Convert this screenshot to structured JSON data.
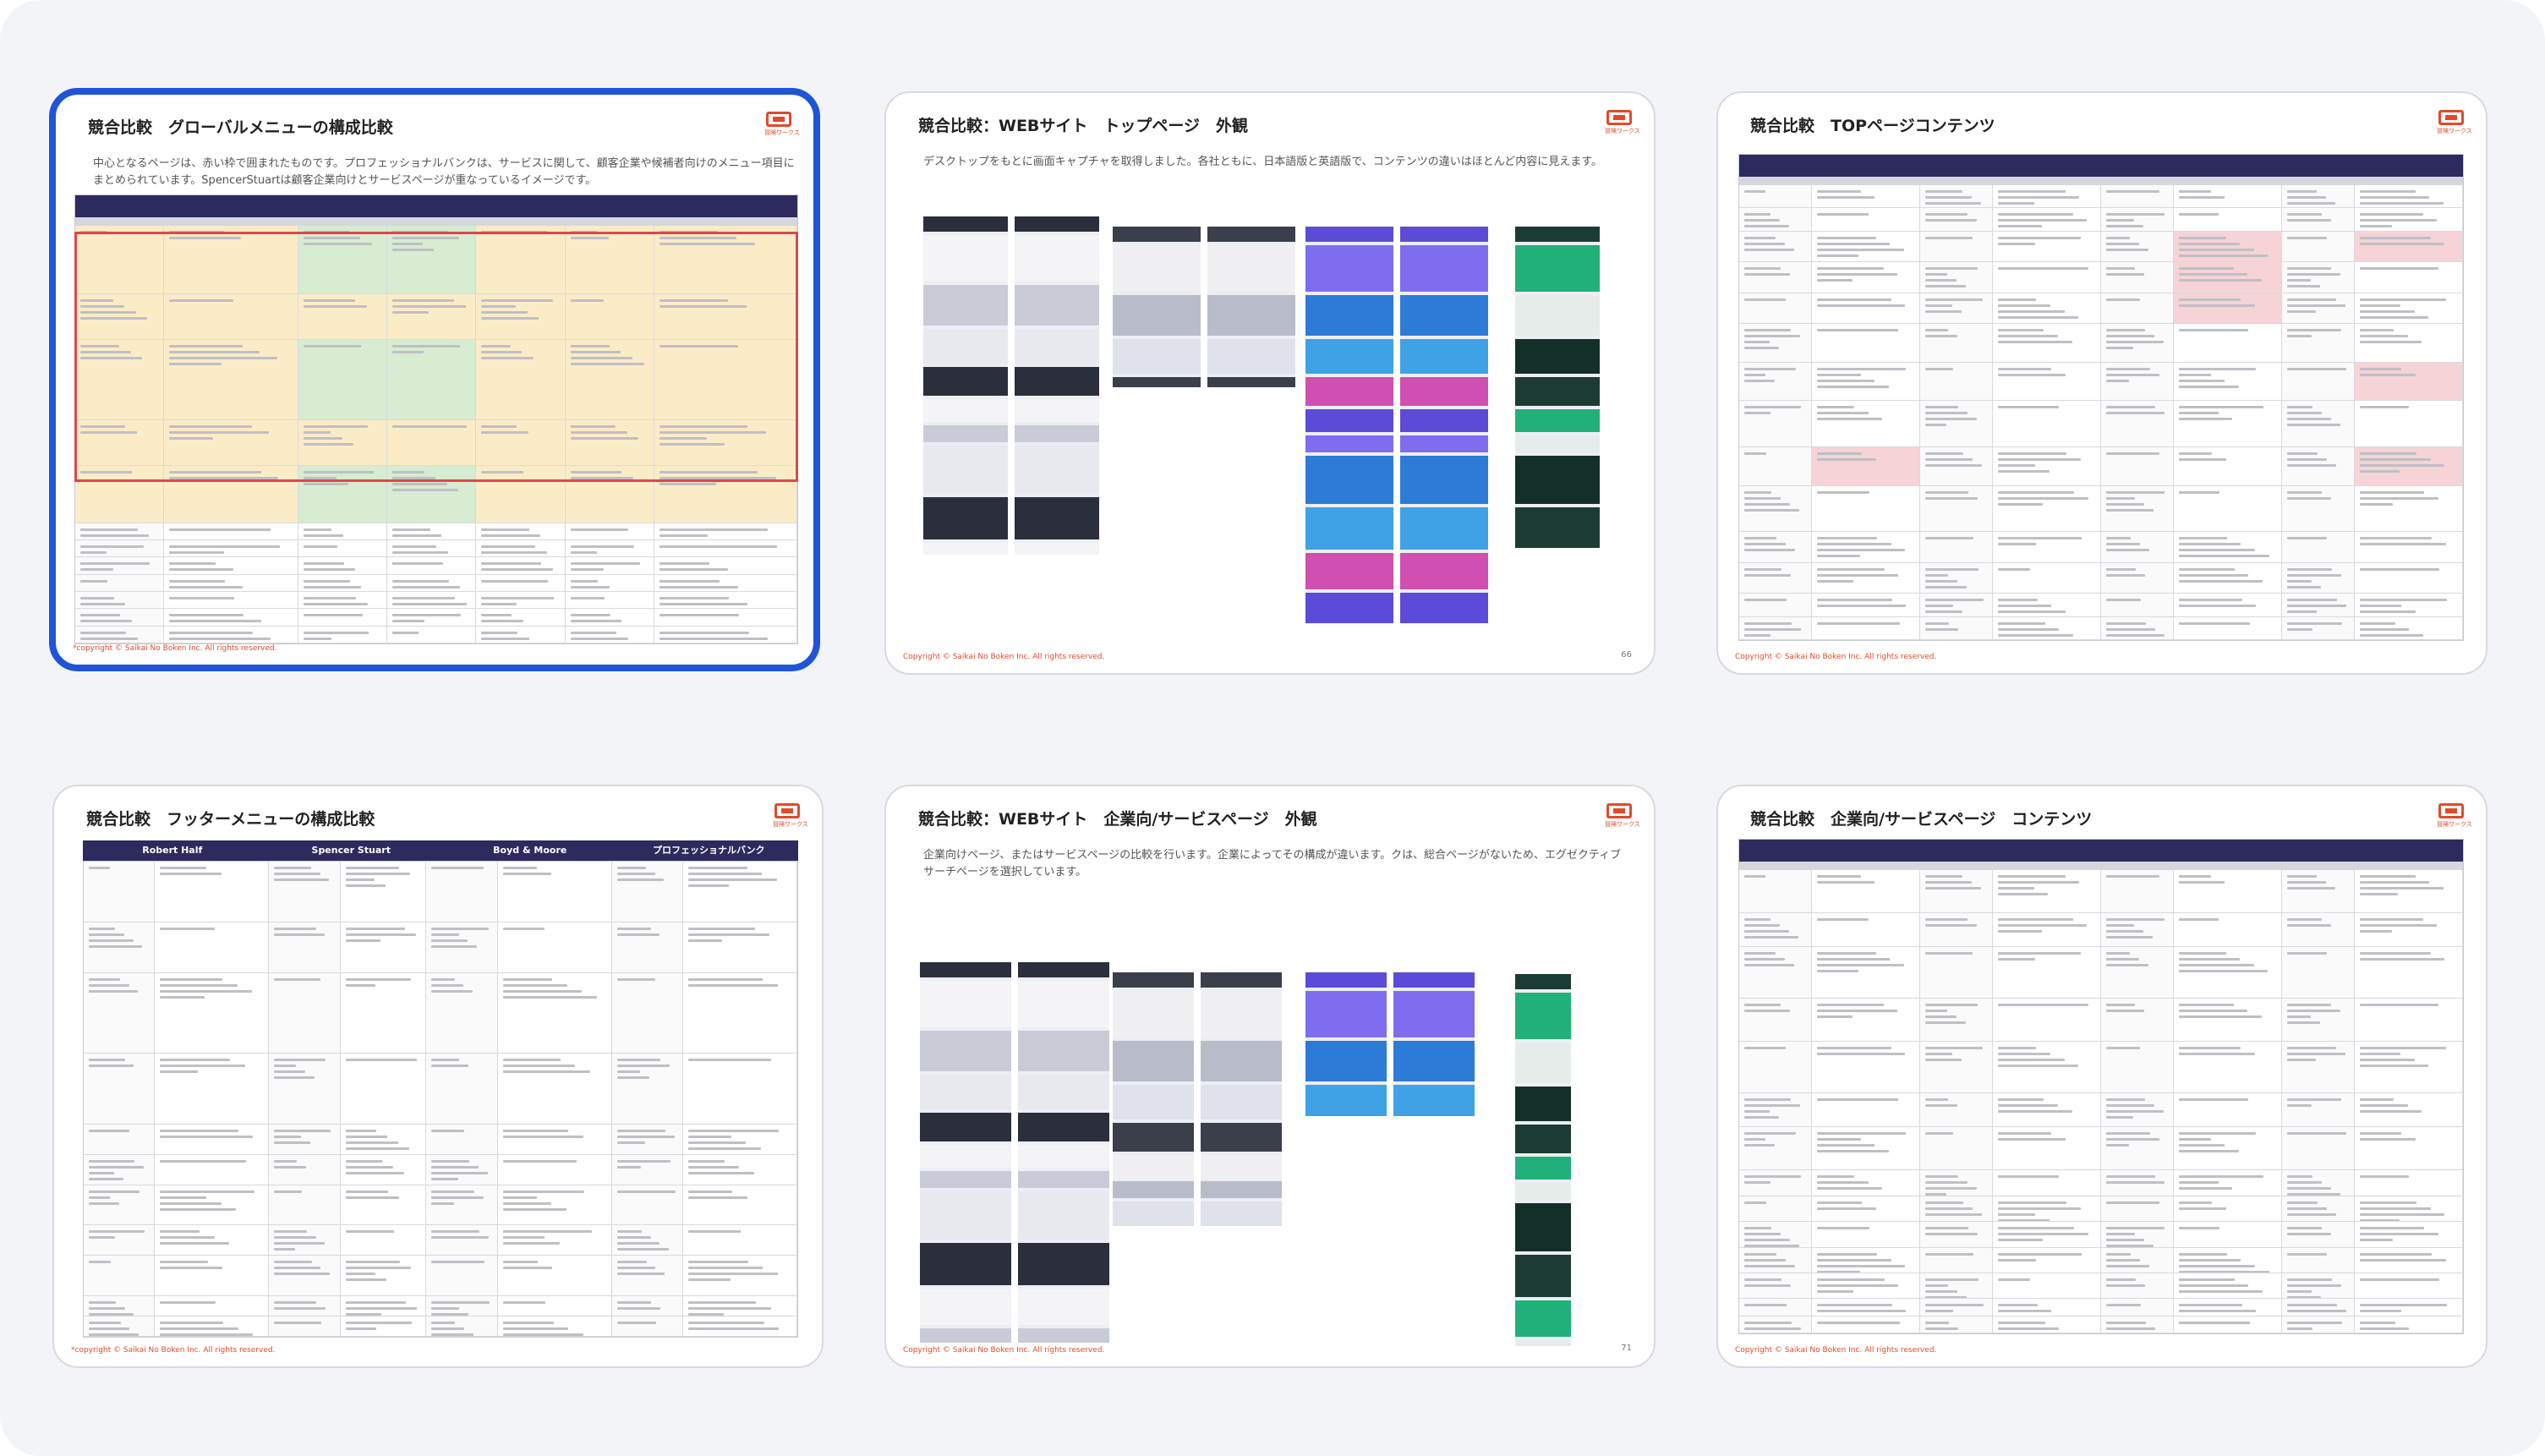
{
  "window": {
    "background_color": "#f3f4f7",
    "selection_color": "#1f54d8"
  },
  "slides": [
    {
      "title": "競合比較　グローバルメニューの構成比較",
      "description": "中心となるページは、赤い枠で囲まれたものです。プロフェッショナルバンクは、サービスに関して、顧客企業や候補者向けのメニュー項目にまとめられています。SpencerStuartは顧客企業向けとサービスページが重なっているイメージです。",
      "copyright": "*copyright © Saikai No Boken Inc. All rights reserved.",
      "page": "",
      "selected": true
    },
    {
      "title": "競合比較：WEBサイト　トップページ　外観",
      "description": "デスクトップをもとに画面キャプチャを取得しました。各社ともに、日本語版と英語版で、コンテンツの違いはほとんど内容に見えます。",
      "copyright": "Copyright © Saikai No Boken Inc. All rights reserved.",
      "page": "66",
      "selected": false
    },
    {
      "title": "競合比較　TOPページコンテンツ",
      "description": "",
      "copyright": "Copyright © Saikai No Boken Inc. All rights reserved.",
      "page": "",
      "selected": false
    },
    {
      "title": "競合比較　フッターメニューの構成比較",
      "description": "",
      "copyright": "*copyright © Saikai No Boken Inc. All rights reserved.",
      "page": "",
      "selected": false
    },
    {
      "title": "競合比較：WEBサイト　企業向/サービスページ　外観",
      "description": "企業向けページ、またはサービスページの比較を行います。企業によってその構成が違います。クは、総合ページがないため、エグゼクティブサーチページを選択しています。",
      "copyright": "Copyright © Saikai No Boken Inc. All rights reserved.",
      "page": "71",
      "selected": false
    },
    {
      "title": "競合比較　企業向/サービスページ　コンテンツ",
      "description": "",
      "copyright": "Copyright © Saikai No Boken Inc. All rights reserved.",
      "page": "",
      "selected": false
    }
  ],
  "footer_table_headers": [
    "Robert Half",
    "Spencer Stuart",
    "Boyd & Moore",
    "プロフェッショナルバンク"
  ],
  "logo": {
    "icon": "briefcase-logo-icon",
    "color": "#e04b2a"
  }
}
